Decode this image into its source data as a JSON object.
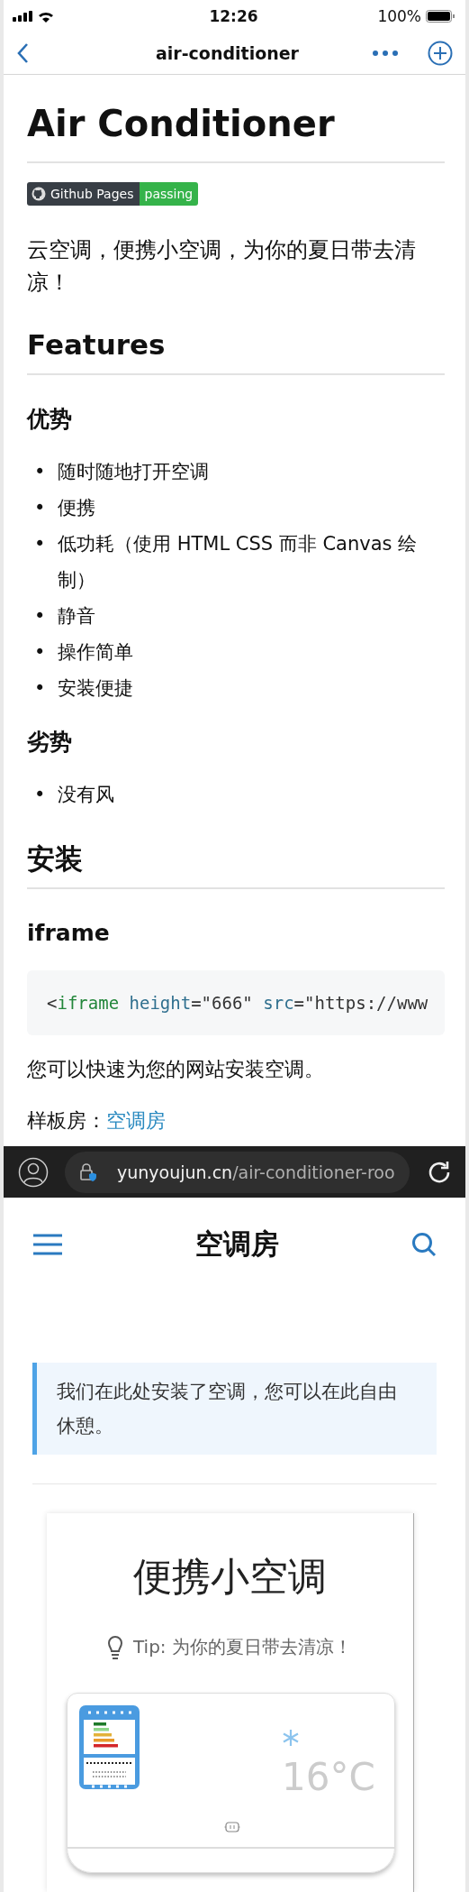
{
  "status_bar": {
    "time": "12:26",
    "battery": "100%"
  },
  "nav": {
    "title": "air-conditioner"
  },
  "readme": {
    "title": "Air Conditioner",
    "badge": {
      "label": "Github Pages",
      "status": "passing"
    },
    "intro": "云空调，便携小空调，为你的夏日带去清凉！",
    "blocks": [
      {
        "kind": "h2",
        "text": "Features"
      },
      {
        "kind": "h3",
        "text": "优势"
      },
      {
        "kind": "list",
        "marker": "•",
        "items": [
          "随时随地打开空调",
          "便携",
          "低功耗（使用 HTML CSS 而非 Canvas 绘制）",
          "静音",
          "操作简单",
          "安装便捷"
        ]
      },
      {
        "kind": "h3",
        "text": "劣势"
      },
      {
        "kind": "list",
        "marker": "•",
        "items": [
          "没有风"
        ]
      },
      {
        "kind": "h2",
        "text": "安装"
      },
      {
        "kind": "h3",
        "text": "iframe"
      },
      {
        "kind": "code",
        "tokens": [
          {
            "kind": "punct",
            "text": "<"
          },
          {
            "kind": "tag",
            "text": "iframe"
          },
          {
            "kind": "attr",
            "text": " height"
          },
          {
            "kind": "punct",
            "text": "=\"666\" "
          },
          {
            "kind": "attr",
            "text": "src"
          },
          {
            "kind": "punct",
            "text": "=\"https://www"
          }
        ]
      },
      {
        "kind": "p",
        "text": "您可以快速为您的网站安装空调。"
      },
      {
        "kind": "link_line",
        "label": "样板房：",
        "link": "空调房"
      }
    ]
  },
  "browser_bar": {
    "host": "yunyoujun.cn",
    "path": "/air-conditioner-roo"
  },
  "room": {
    "title": "空调房",
    "notice": "我们在此处安装了空调，您可以在此自由休憩。",
    "card_title": "便携小空调",
    "tip": "Tip: 为你的夏日带去清凉！",
    "temperature": "16°C"
  }
}
